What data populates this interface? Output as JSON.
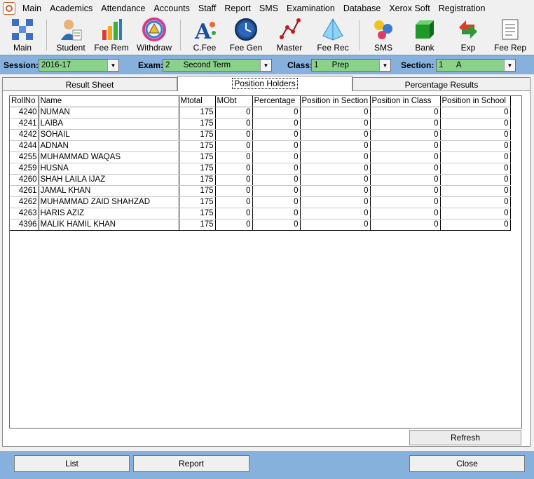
{
  "menu": [
    "Main",
    "Academics",
    "Attendance",
    "Accounts",
    "Staff",
    "Report",
    "SMS",
    "Examination",
    "Database",
    "Xerox Soft",
    "Registration"
  ],
  "toolbar": [
    {
      "label": "Main",
      "icon": "main-icon"
    },
    {
      "label": "Student",
      "icon": "student-icon"
    },
    {
      "label": "Fee Rem",
      "icon": "fee-rem-icon"
    },
    {
      "label": "Withdraw",
      "icon": "withdraw-icon"
    },
    {
      "label": "C.Fee",
      "icon": "c-fee-icon"
    },
    {
      "label": "Fee Gen",
      "icon": "fee-gen-icon"
    },
    {
      "label": "Master",
      "icon": "master-icon"
    },
    {
      "label": "Fee Rec",
      "icon": "fee-rec-icon"
    },
    {
      "label": "SMS",
      "icon": "sms-icon"
    },
    {
      "label": "Bank",
      "icon": "bank-icon"
    },
    {
      "label": "Exp",
      "icon": "exp-icon"
    },
    {
      "label": "Fee Rep",
      "icon": "fee-rep-icon"
    }
  ],
  "filters": {
    "session_label": "Session:",
    "session_value": "2016-17",
    "exam_label": "Exam:",
    "exam_value": "2      Second Term",
    "class_label": "Class:",
    "class_value": "1      Prep",
    "section_label": "Section:",
    "section_value": "1      A"
  },
  "tabs": [
    "Result Sheet",
    "Position Holders",
    "Percentage Results"
  ],
  "active_tab": "Position Holders",
  "grid": {
    "columns": [
      "RollNo",
      "Name",
      "Mtotal",
      "MObt",
      "Percentage",
      "Position in Section",
      "Position in Class",
      "Position in School"
    ],
    "rows": [
      [
        "4240",
        "NUMAN",
        "175",
        "0",
        "0",
        "0",
        "0",
        "0"
      ],
      [
        "4241",
        "LAIBA",
        "175",
        "0",
        "0",
        "0",
        "0",
        "0"
      ],
      [
        "4242",
        "SOHAIL",
        "175",
        "0",
        "0",
        "0",
        "0",
        "0"
      ],
      [
        "4244",
        "ADNAN",
        "175",
        "0",
        "0",
        "0",
        "0",
        "0"
      ],
      [
        "4255",
        "MUHAMMAD WAQAS",
        "175",
        "0",
        "0",
        "0",
        "0",
        "0"
      ],
      [
        "4259",
        "HUSNA",
        "175",
        "0",
        "0",
        "0",
        "0",
        "0"
      ],
      [
        "4260",
        "SHAH LAILA IJAZ",
        "175",
        "0",
        "0",
        "0",
        "0",
        "0"
      ],
      [
        "4261",
        "JAMAL KHAN",
        "175",
        "0",
        "0",
        "0",
        "0",
        "0"
      ],
      [
        "4262",
        "MUHAMMAD ZAID SHAHZAD",
        "175",
        "0",
        "0",
        "0",
        "0",
        "0"
      ],
      [
        "4263",
        "HARIS AZIZ",
        "175",
        "0",
        "0",
        "0",
        "0",
        "0"
      ],
      [
        "4396",
        "MALIK HAMIL KHAN",
        "175",
        "0",
        "0",
        "0",
        "0",
        "0"
      ]
    ]
  },
  "buttons": {
    "refresh": "Refresh",
    "list": "List",
    "report": "Report",
    "close": "Close"
  },
  "colors": {
    "panel_blue": "#87b1dd",
    "combo_green": "#8ad18a"
  }
}
